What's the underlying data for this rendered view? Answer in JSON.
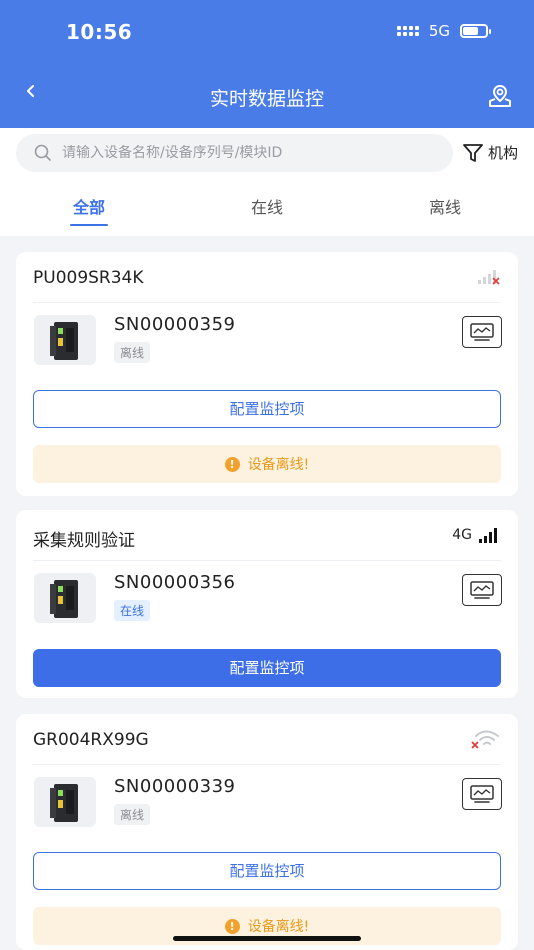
{
  "status_bar": {
    "time": "10:56",
    "network": "5G"
  },
  "header": {
    "title": "实时数据监控"
  },
  "search": {
    "placeholder": "请输入设备名称/设备序列号/模块ID"
  },
  "filter": {
    "label": "机构"
  },
  "tabs": [
    {
      "label": "全部",
      "active": true
    },
    {
      "label": "在线",
      "active": false
    },
    {
      "label": "离线",
      "active": false
    }
  ],
  "devices": [
    {
      "name": "PU009SR34K",
      "sn": "SN00000359",
      "status": "离线",
      "signal_icon": "cellular-signal-none-icon",
      "config_label": "配置监控项",
      "warning": "设备离线!"
    },
    {
      "name": "采集规则验证",
      "sn": "SN00000356",
      "status": "在线",
      "network": "4G",
      "signal_icon": "cellular-signal-full-icon",
      "config_label": "配置监控项"
    },
    {
      "name": "GR004RX99G",
      "sn": "SN00000339",
      "status": "离线",
      "signal_icon": "wifi-disconnected-icon",
      "config_label": "配置监控项",
      "warning": "设备离线!"
    }
  ],
  "colors": {
    "primary": "#4a7ce8",
    "warning": "#e89a1c",
    "warning_bg": "#fcf2df"
  }
}
